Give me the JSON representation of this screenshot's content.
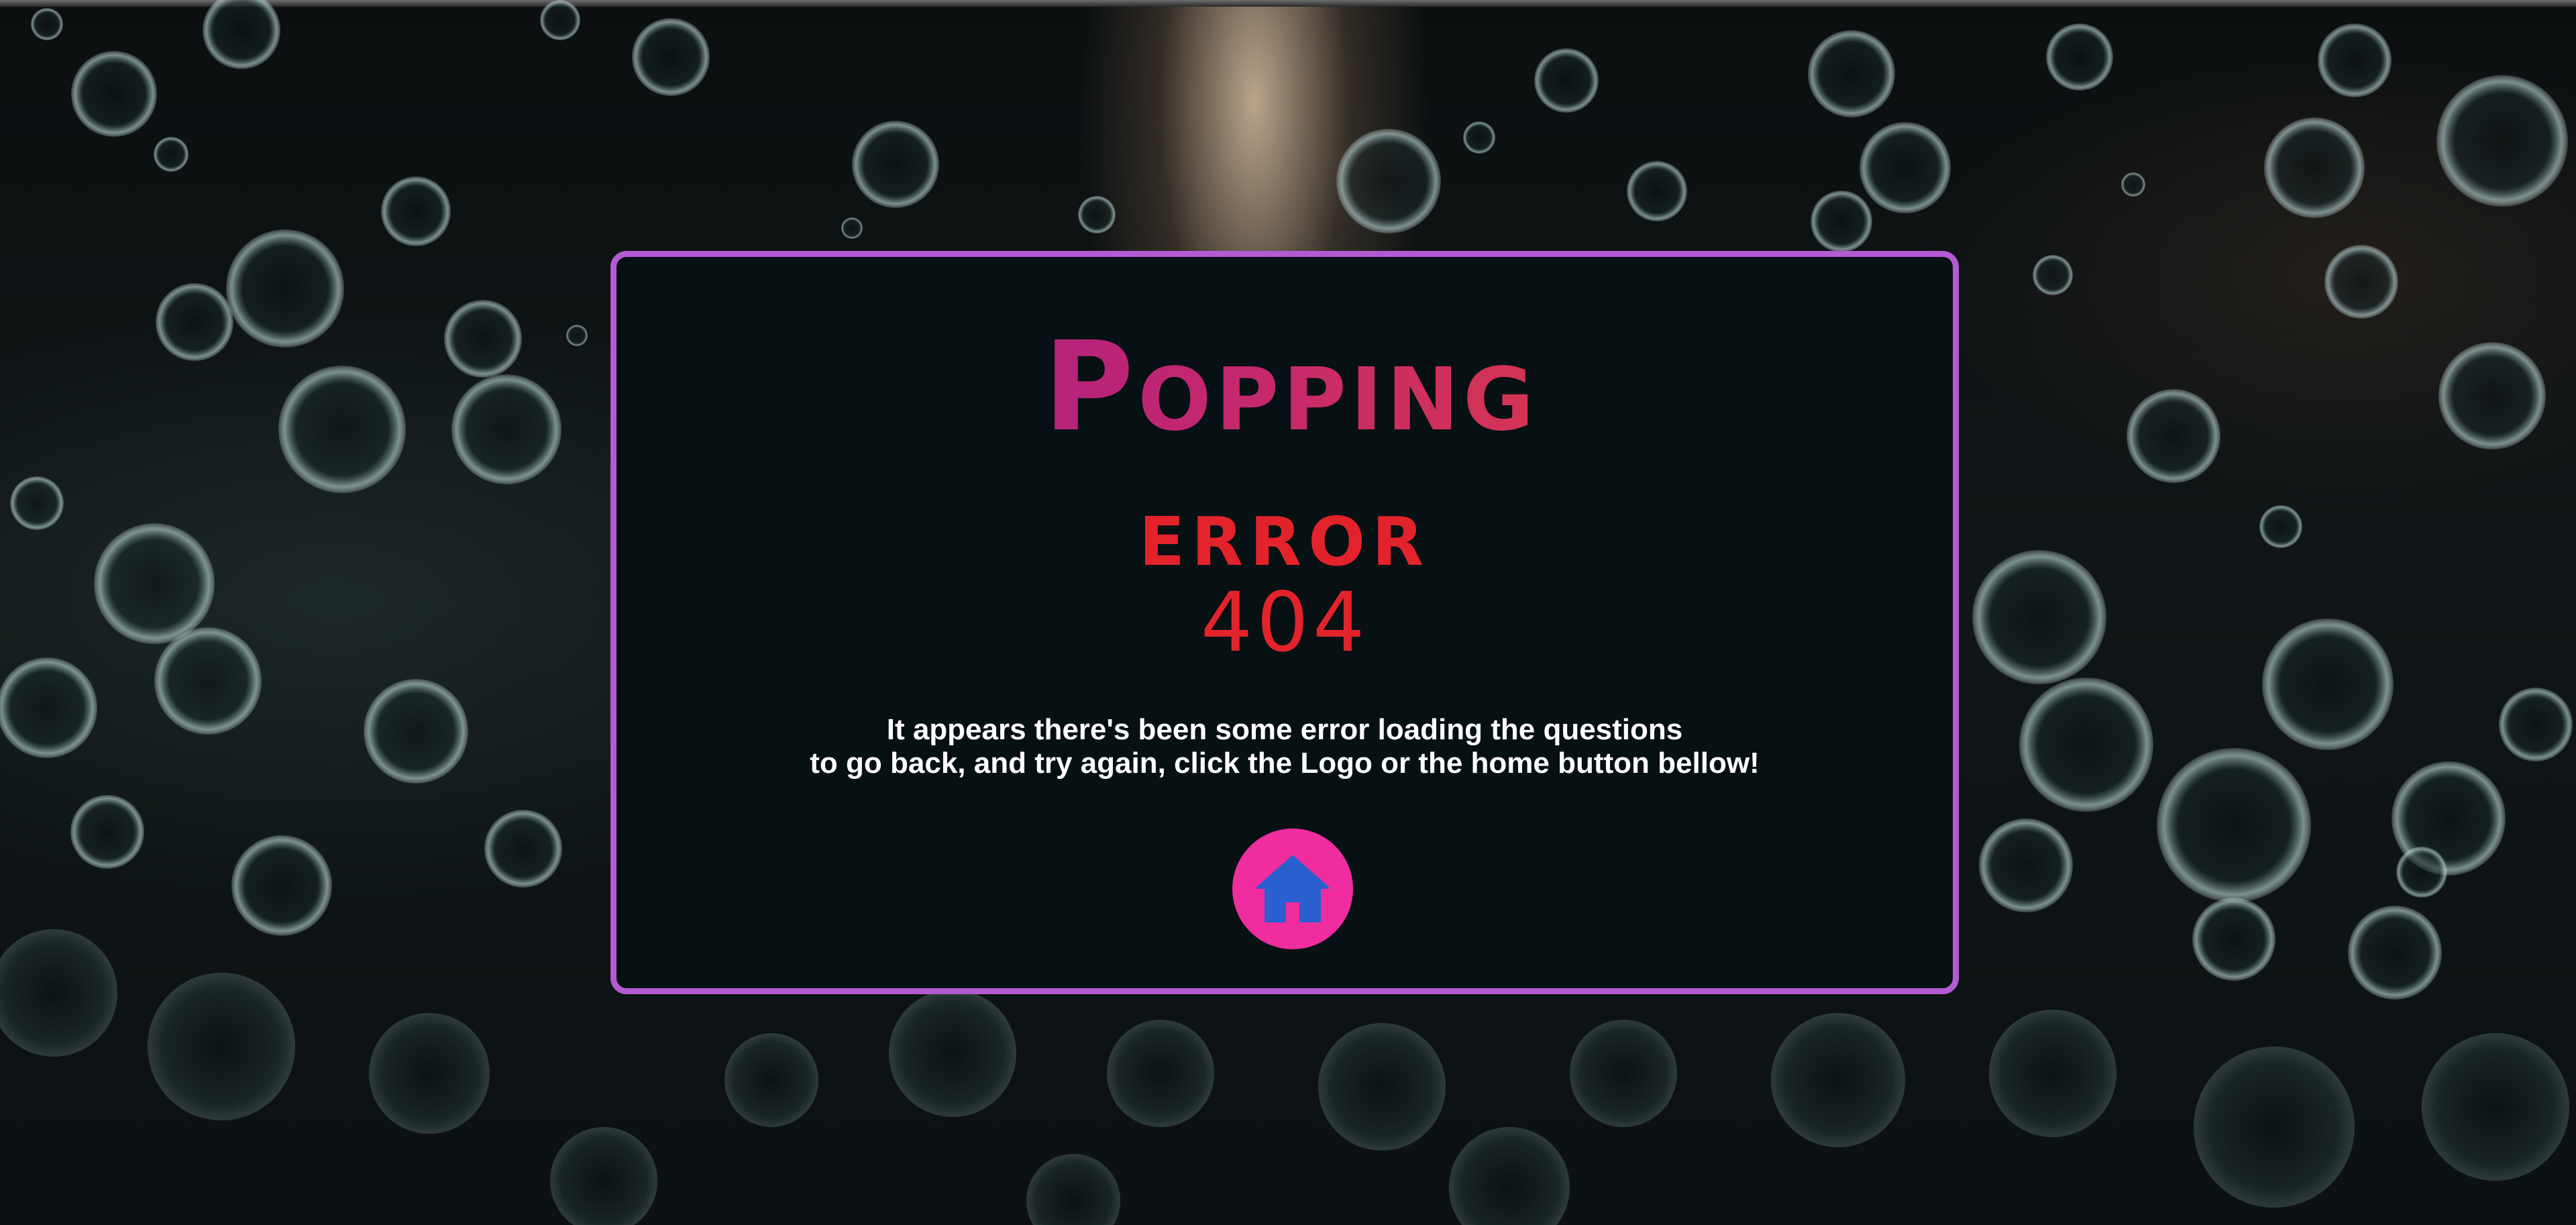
{
  "logo": {
    "text": "Popping"
  },
  "error": {
    "label": "ERROR",
    "code": "404"
  },
  "message": {
    "line1": "It appears there's been some error loading the questions",
    "line2": "to go back, and try again, click the Logo or the home button bellow!"
  },
  "home_button": {
    "icon": "home-icon"
  },
  "colors": {
    "card_border": "#b45ad2",
    "card_background": "#071013",
    "error_red": "#e3232b",
    "home_button": "#ef2d9e",
    "home_icon": "#2a5fd0",
    "logo_gradient_start": "#931a9c",
    "logo_gradient_end": "#e8462f"
  }
}
